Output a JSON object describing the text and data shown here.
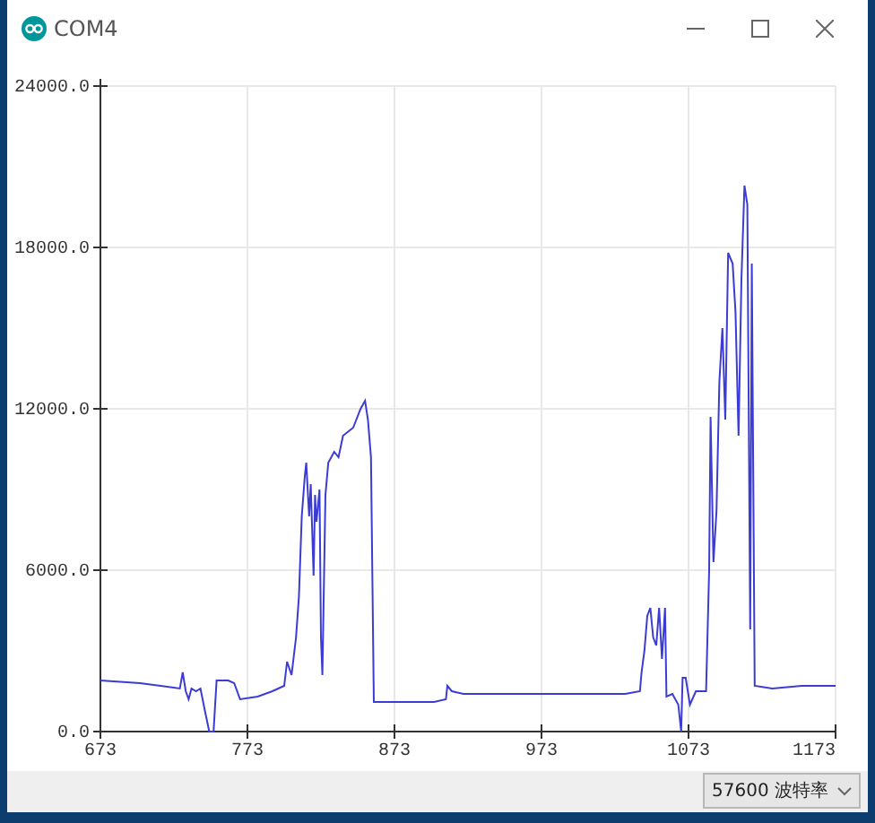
{
  "window": {
    "title": "COM4"
  },
  "chart_data": {
    "type": "line",
    "x": [
      673,
      700,
      714,
      727,
      729,
      731,
      733,
      735,
      738,
      741,
      744,
      747,
      750,
      752,
      760,
      764,
      768,
      780,
      790,
      798,
      800,
      803,
      806,
      808,
      810,
      812,
      813,
      815,
      816,
      818,
      819,
      820,
      822,
      823,
      824,
      826,
      828,
      832,
      835,
      838,
      845,
      850,
      853,
      855,
      857,
      859,
      870,
      880,
      900,
      908,
      909,
      912,
      920,
      1000,
      1030,
      1040,
      1041,
      1043,
      1045,
      1047,
      1049,
      1051,
      1053,
      1055,
      1057,
      1058,
      1062,
      1066,
      1068,
      1069,
      1071,
      1074,
      1078,
      1085,
      1087,
      1088,
      1090,
      1092,
      1094,
      1096,
      1098,
      1100,
      1103,
      1105,
      1107,
      1109,
      1111,
      1113,
      1115,
      1116,
      1118,
      1130,
      1150,
      1173
    ],
    "series": [
      {
        "color": "#3c3cd4",
        "values": [
          1900,
          1800,
          1700,
          1600,
          2200,
          1500,
          1200,
          1600,
          1500,
          1600,
          800,
          0,
          0,
          1900,
          1900,
          1800,
          1200,
          1300,
          1500,
          1700,
          2600,
          2100,
          3500,
          5000,
          8000,
          9500,
          10000,
          8000,
          9200,
          5800,
          8800,
          7800,
          9000,
          3500,
          2100,
          8800,
          10000,
          10400,
          10200,
          11000,
          11300,
          12000,
          12300,
          11600,
          10200,
          1100,
          1100,
          1100,
          1100,
          1200,
          1700,
          1500,
          1400,
          1400,
          1400,
          1500,
          2200,
          3000,
          4300,
          4600,
          3500,
          3200,
          4600,
          2700,
          4600,
          1300,
          1400,
          1000,
          0,
          2000,
          2000,
          1000,
          1500,
          1500,
          6000,
          11700,
          6300,
          8200,
          13000,
          15000,
          11600,
          17800,
          17400,
          15600,
          11000,
          16800,
          20300,
          19600,
          3800,
          17400,
          1700,
          1600,
          1700,
          1700
        ]
      }
    ],
    "grid": true,
    "xlim": [
      673,
      1173
    ],
    "ylim": [
      0,
      24000
    ],
    "xticks": [
      673,
      773,
      873,
      973,
      1073,
      1173
    ],
    "yticks": [
      {
        "value": 0,
        "label": "0.0"
      },
      {
        "value": 6000,
        "label": "6000.0"
      },
      {
        "value": 12000,
        "label": "12000.0"
      },
      {
        "value": 18000,
        "label": "18000.0"
      },
      {
        "value": 24000,
        "label": "24000.0"
      }
    ]
  },
  "baud_rate": {
    "value": "57600 波特率"
  }
}
